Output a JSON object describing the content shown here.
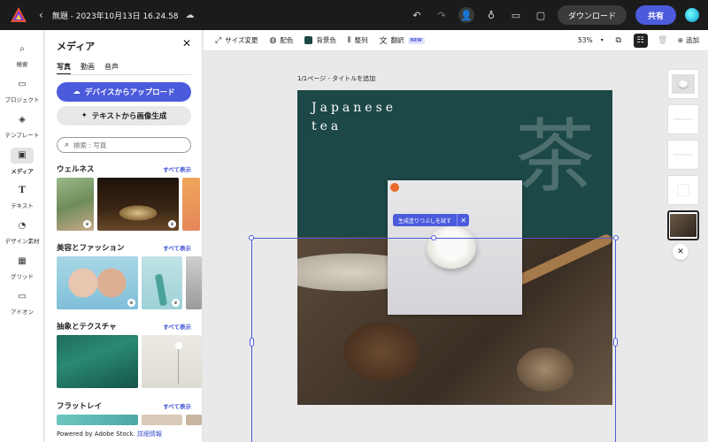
{
  "topbar": {
    "doc_title": "無題 - 2023年10月13日 16.24.58",
    "download_label": "ダウンロード",
    "share_label": "共有"
  },
  "rail": {
    "items": [
      {
        "label": "検索",
        "icon": "search-icon"
      },
      {
        "label": "プロジェクト",
        "icon": "folder-icon"
      },
      {
        "label": "テンプレート",
        "icon": "template-icon"
      },
      {
        "label": "メディア",
        "icon": "media-icon",
        "active": true
      },
      {
        "label": "テキスト",
        "icon": "text-icon"
      },
      {
        "label": "デザイン素材",
        "icon": "shapes-icon"
      },
      {
        "label": "グリッド",
        "icon": "grid-icon"
      },
      {
        "label": "アドオン",
        "icon": "addon-icon"
      }
    ]
  },
  "panel": {
    "title": "メディア",
    "tabs": [
      "写真",
      "動画",
      "音声"
    ],
    "upload_label": "デバイスからアップロード",
    "generate_label": "テキストから画像生成",
    "search_placeholder": "検索 : 写真",
    "sections": [
      {
        "title": "ウェルネス",
        "link": "すべて表示"
      },
      {
        "title": "美容とファッション",
        "link": "すべて表示"
      },
      {
        "title": "抽象とテクスチャ",
        "link": "すべて表示"
      },
      {
        "title": "フラットレイ",
        "link": "すべて表示"
      }
    ],
    "powered": "Powered by Adobe Stock.",
    "powered_link": "詳細情報"
  },
  "toolbar": {
    "resize": "サイズ変更",
    "colors": "配色",
    "background": "背景色",
    "arrange": "整列",
    "translate": "翻訳",
    "new_badge": "NEW",
    "zoom": "53%",
    "add": "追加"
  },
  "canvas": {
    "page_label": "1/1ページ - タイトルを追加",
    "title_line1": "Japanese",
    "title_line2": "tea",
    "kanji": "茶",
    "gen_fill_label": "生成塗りつぶしを試す"
  },
  "colors": {
    "accent": "#4b5bdc",
    "page_green": "#1c4847",
    "topbar": "#1b1b1b"
  }
}
